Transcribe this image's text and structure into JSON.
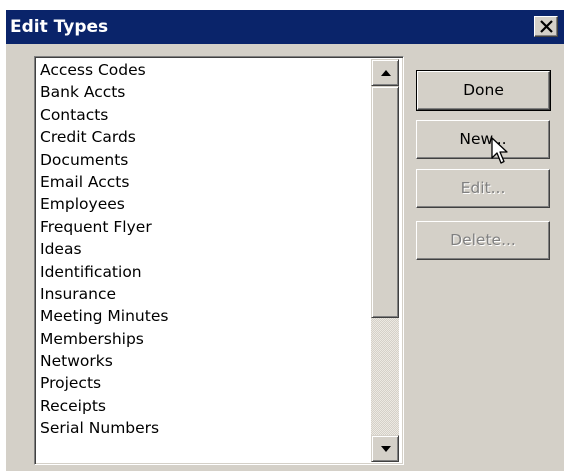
{
  "window": {
    "title": "Edit Types",
    "close_glyph": "×",
    "close_icon": "close-icon"
  },
  "list": {
    "items": [
      "Access Codes",
      "Bank Accts",
      "Contacts",
      "Credit Cards",
      "Documents",
      "Email Accts",
      "Employees",
      "Frequent Flyer",
      "Ideas",
      "Identification",
      "Insurance",
      "Meeting Minutes",
      "Memberships",
      "Networks",
      "Projects",
      "Receipts",
      "Serial Numbers"
    ],
    "scroll_up_icon": "scroll-up-arrow-icon",
    "scroll_down_icon": "scroll-down-arrow-icon"
  },
  "buttons": {
    "done": "Done",
    "new": "New...",
    "edit": "Edit...",
    "delete": "Delete..."
  },
  "state": {
    "edit_enabled": false,
    "delete_enabled": false,
    "default_button": "done"
  },
  "cursor_icon": "mouse-pointer-icon"
}
